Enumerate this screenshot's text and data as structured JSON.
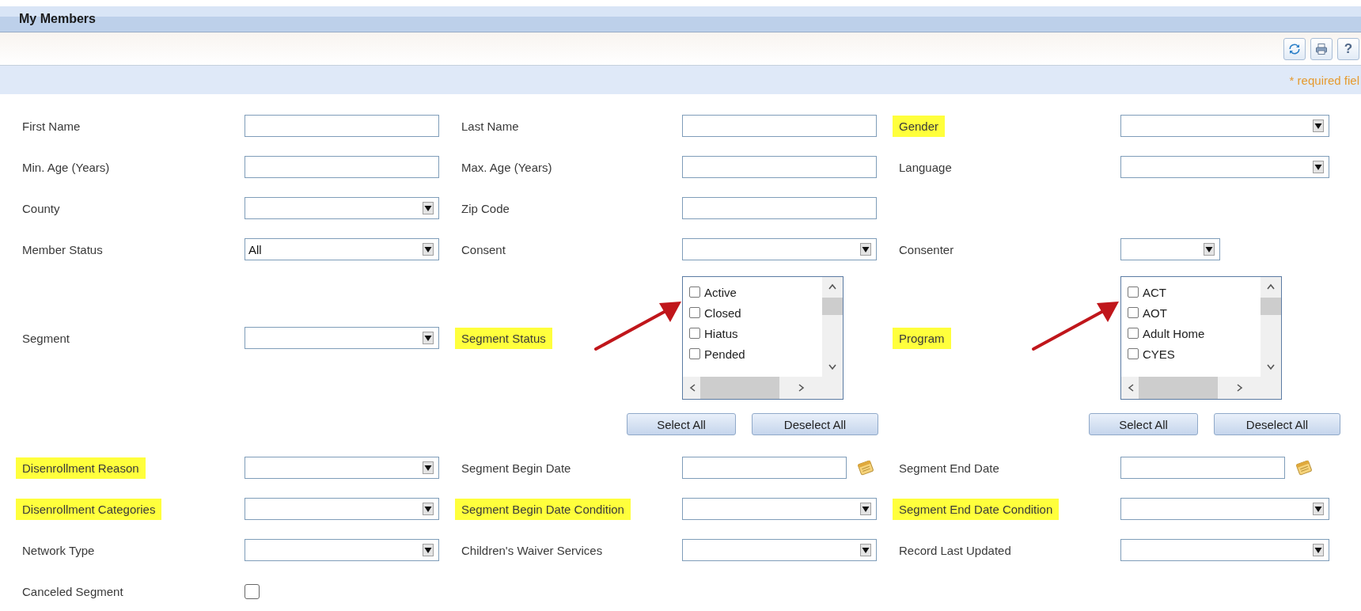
{
  "header": {
    "title": "My Members"
  },
  "toolbar": [
    {
      "kind": "refresh"
    },
    {
      "kind": "print"
    },
    {
      "kind": "help",
      "label": "?"
    }
  ],
  "required_note": "* required fiel",
  "rows": [
    [
      {
        "label": "First Name",
        "highlighted": false,
        "control": {
          "kind": "text"
        }
      },
      {
        "label": "Last Name",
        "highlighted": false,
        "control": {
          "kind": "text"
        }
      },
      {
        "label": "Gender",
        "highlighted": true,
        "control": {
          "kind": "select"
        }
      }
    ],
    [
      {
        "label": "Min. Age (Years)",
        "highlighted": false,
        "control": {
          "kind": "text"
        }
      },
      {
        "label": "Max. Age (Years)",
        "highlighted": false,
        "control": {
          "kind": "text"
        }
      },
      {
        "label": "Language",
        "highlighted": false,
        "control": {
          "kind": "select"
        }
      }
    ],
    [
      {
        "label": "County",
        "highlighted": false,
        "control": {
          "kind": "select"
        }
      },
      {
        "label": "Zip Code",
        "highlighted": false,
        "control": {
          "kind": "text"
        }
      }
    ],
    [
      {
        "label": "Member Status",
        "highlighted": false,
        "control": {
          "kind": "select",
          "value": "All"
        }
      },
      {
        "label": "Consent",
        "highlighted": false,
        "control": {
          "kind": "select"
        }
      },
      {
        "label": "Consenter",
        "highlighted": false,
        "control": {
          "kind": "short-select"
        }
      }
    ],
    [
      {
        "label": "Segment",
        "highlighted": false,
        "control": {
          "kind": "select"
        }
      },
      {
        "label": "Segment Status",
        "highlighted": true,
        "annotated": true,
        "control": {
          "kind": "multiselect",
          "options": [
            {
              "label": "Active",
              "checked": false
            },
            {
              "label": "Closed",
              "checked": false
            },
            {
              "label": "Hiatus",
              "checked": false
            },
            {
              "label": "Pended",
              "checked": false
            }
          ],
          "buttons": [
            "Select All",
            "Deselect All"
          ]
        }
      },
      {
        "label": "Program",
        "highlighted": true,
        "annotated": true,
        "control": {
          "kind": "multiselect",
          "options": [
            {
              "label": "ACT",
              "checked": false
            },
            {
              "label": "AOT",
              "checked": false
            },
            {
              "label": "Adult Home",
              "checked": false
            },
            {
              "label": "CYES",
              "checked": false
            }
          ],
          "buttons": [
            "Select All",
            "Deselect All"
          ]
        }
      }
    ],
    [
      {
        "label": "Disenrollment Reason",
        "highlighted": true,
        "control": {
          "kind": "select"
        }
      },
      {
        "label": "Segment Begin Date",
        "highlighted": false,
        "control": {
          "kind": "date"
        }
      },
      {
        "label": "Segment End Date",
        "highlighted": false,
        "control": {
          "kind": "date"
        }
      }
    ],
    [
      {
        "label": "Disenrollment Categories",
        "highlighted": true,
        "control": {
          "kind": "select"
        }
      },
      {
        "label": "Segment Begin Date Condition",
        "highlighted": true,
        "control": {
          "kind": "select"
        }
      },
      {
        "label": "Segment End Date Condition",
        "highlighted": true,
        "control": {
          "kind": "select"
        }
      }
    ],
    [
      {
        "label": "Network Type",
        "highlighted": false,
        "control": {
          "kind": "select"
        }
      },
      {
        "label": "Children's Waiver Services",
        "highlighted": false,
        "control": {
          "kind": "select"
        }
      },
      {
        "label": "Record Last Updated",
        "highlighted": false,
        "control": {
          "kind": "select"
        }
      }
    ],
    [
      {
        "label": "Canceled Segment",
        "highlighted": false,
        "control": {
          "kind": "checkbox",
          "checked": false
        }
      }
    ]
  ]
}
